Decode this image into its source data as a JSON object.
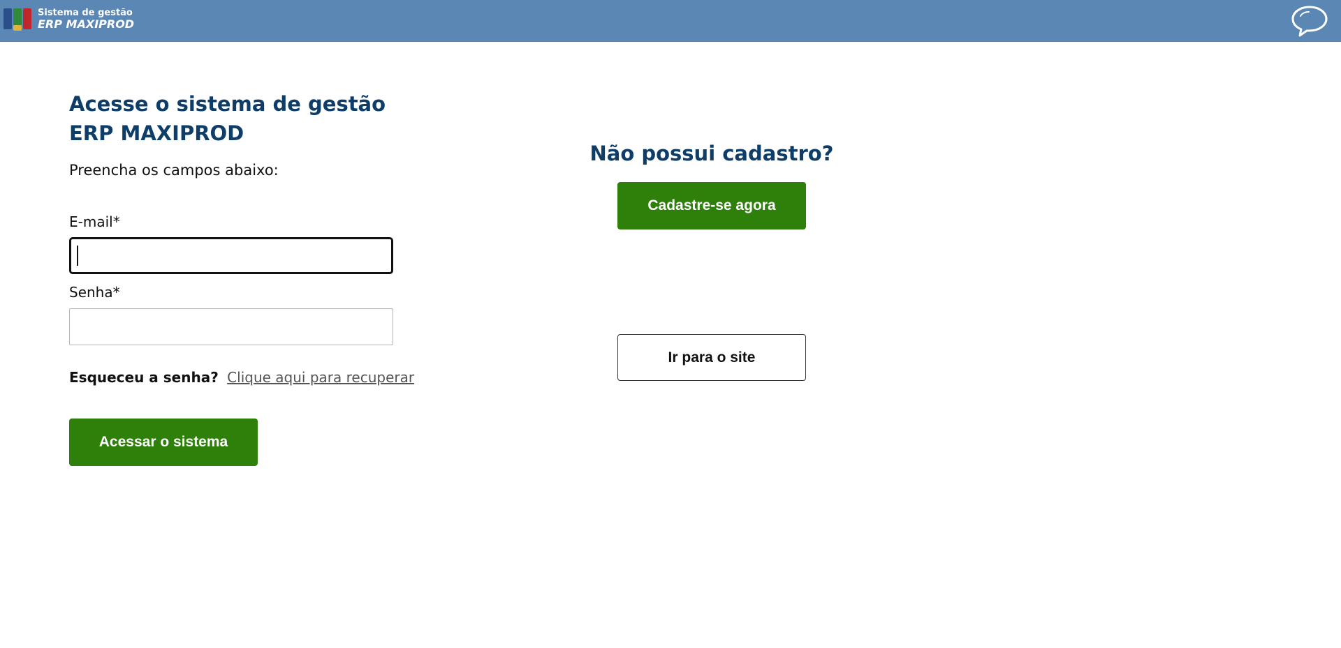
{
  "header": {
    "logo_line1": "Sistema de gestão",
    "logo_line2": "ERP MAXIPROD",
    "chat_icon": "speech-bubble-icon",
    "background_color": "#5b87b4"
  },
  "login": {
    "heading_line1": "Acesse o sistema de gestão",
    "heading_line2": "ERP MAXIPROD",
    "subtitle": "Preencha os campos abaixo:",
    "email_label": "E-mail*",
    "email_value": "",
    "password_label": "Senha*",
    "password_value": "",
    "forgot_question": "Esqueceu a senha?",
    "forgot_link": "Clique aqui para recuperar",
    "submit_label": "Acessar o sistema"
  },
  "signup": {
    "heading": "Não possui cadastro?",
    "signup_label": "Cadastre-se agora",
    "site_label": "Ir para o site"
  },
  "colors": {
    "heading": "#0e3d68",
    "primary_button": "#2e800b",
    "link": "#555555"
  }
}
